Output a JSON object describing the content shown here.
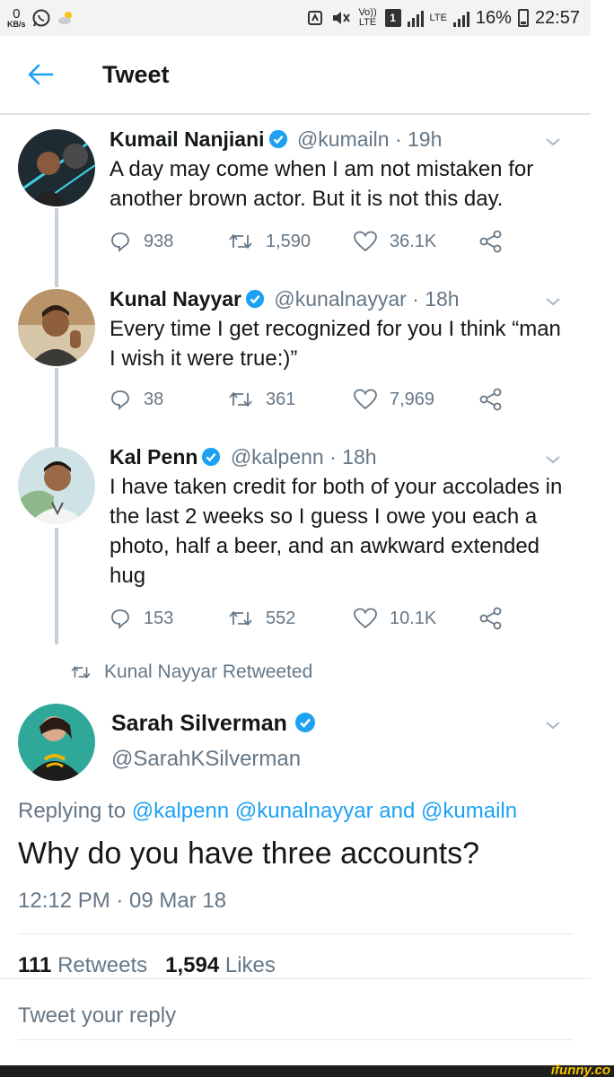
{
  "status_bar": {
    "speed_value": "0",
    "speed_unit": "KB/s",
    "volte": "Vo)) LTE",
    "sim": "1",
    "network": "LTE",
    "battery": "16%",
    "time": "22:57"
  },
  "header": {
    "title": "Tweet"
  },
  "thread": [
    {
      "name": "Kumail Nanjiani",
      "handle": "@kumailn",
      "age": "· 19h",
      "text": "A day may come when I am not mistaken for another brown actor. But it is not this day.",
      "replies": "938",
      "retweets": "1,590",
      "likes": "36.1K"
    },
    {
      "name": "Kunal Nayyar",
      "handle": "@kunalnayyar",
      "age": "· 18h",
      "text": "Every time I get recognized for you I think “man I wish it were true:)”",
      "replies": "38",
      "retweets": "361",
      "likes": "7,969"
    },
    {
      "name": "Kal Penn",
      "handle": "@kalpenn",
      "age": "· 18h",
      "text": "I have taken credit for both of your accolades in the last 2 weeks so I guess I owe you each a photo, half a beer, and an awkward extended hug",
      "replies": "153",
      "retweets": "552",
      "likes": "10.1K"
    }
  ],
  "retweeted_by": "Kunal Nayyar Retweeted",
  "main_tweet": {
    "name": "Sarah Silverman",
    "handle": "@SarahKSilverman",
    "replying_prefix": "Replying to",
    "mentions": "@kalpenn @kunalnayyar",
    "and": "and",
    "last_mention": "@kumailn",
    "text": "Why do you have three accounts?",
    "timestamp": "12:12 PM · 09 Mar 18",
    "retweet_count": "111",
    "retweet_label": "Retweets",
    "like_count": "1,594",
    "like_label": "Likes"
  },
  "reply_placeholder": "Tweet your reply",
  "watermark": "ifunny.co",
  "colors": {
    "accent": "#1da1f2",
    "secondary_text": "#657786",
    "primary_text": "#14171a"
  }
}
